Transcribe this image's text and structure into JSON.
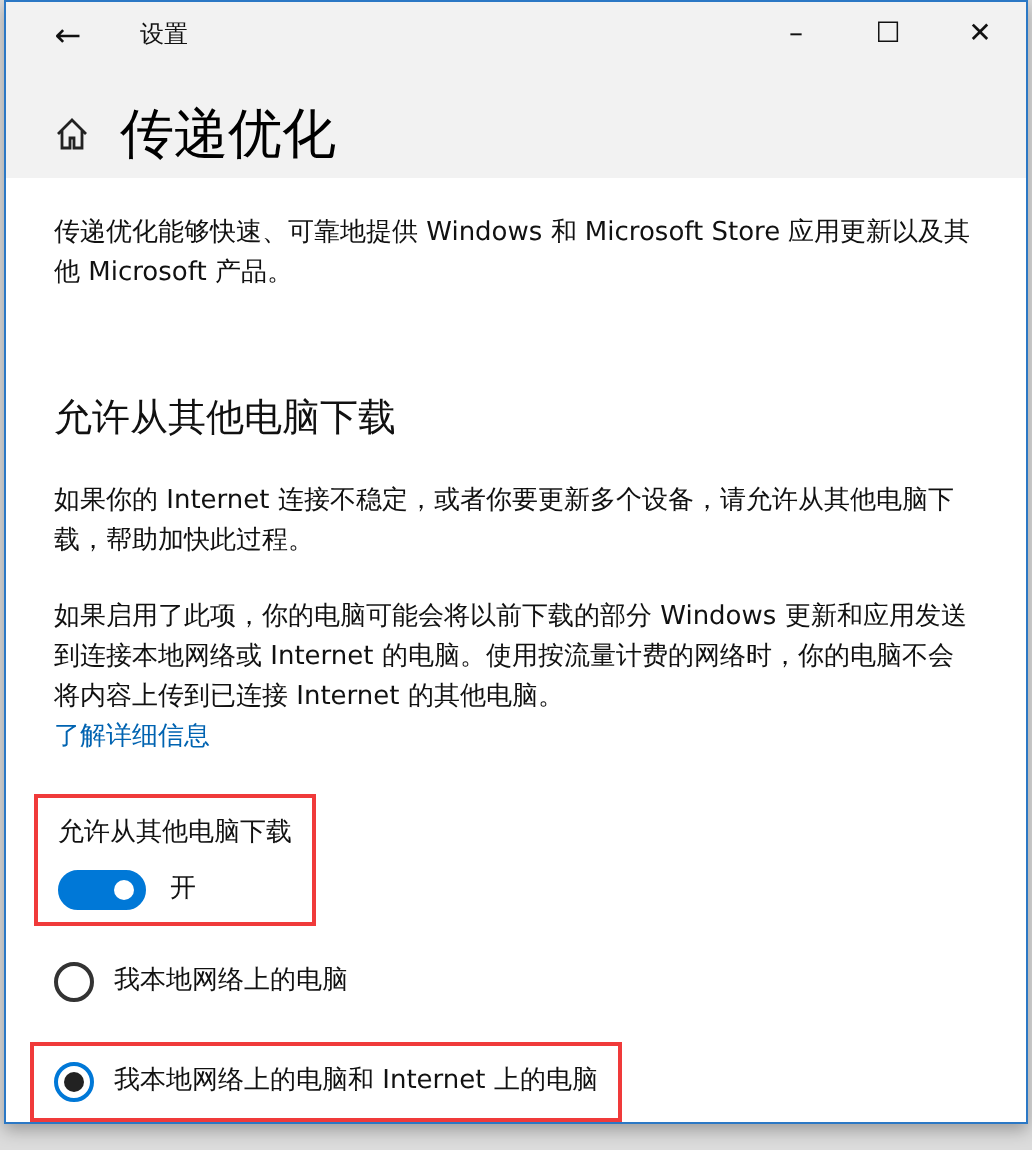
{
  "window": {
    "title": "设置",
    "back": "←",
    "controls": [
      "–",
      "☐",
      "✕"
    ]
  },
  "page": {
    "title": "传递优化"
  },
  "intro": "传递优化能够快速、可靠地提供 Windows 和 Microsoft Store 应用更新以及其他 Microsoft 产品。",
  "section": {
    "heading": "允许从其他电脑下载",
    "paragraphs": [
      "如果你的 Internet 连接不稳定，或者你要更新多个设备，请允许从其他电脑下载，帮助加快此过程。",
      "如果启用了此项，你的电脑可能会将以前下载的部分 Windows 更新和应用发送到连接本地网络或 Internet 的电脑。使用按流量计费的网络时，你的电脑不会将内容上传到已连接 Internet 的其他电脑。"
    ],
    "link": "了解详细信息",
    "toggle": {
      "label": "允许从其他电脑下载",
      "on": true,
      "state_text": "开",
      "highlighted": true
    },
    "options": [
      {
        "label": "我本地网络上的电脑",
        "selected": false,
        "highlighted": false
      },
      {
        "label": "我本地网络上的电脑和 Internet 上的电脑",
        "selected": true,
        "highlighted": true
      }
    ]
  }
}
